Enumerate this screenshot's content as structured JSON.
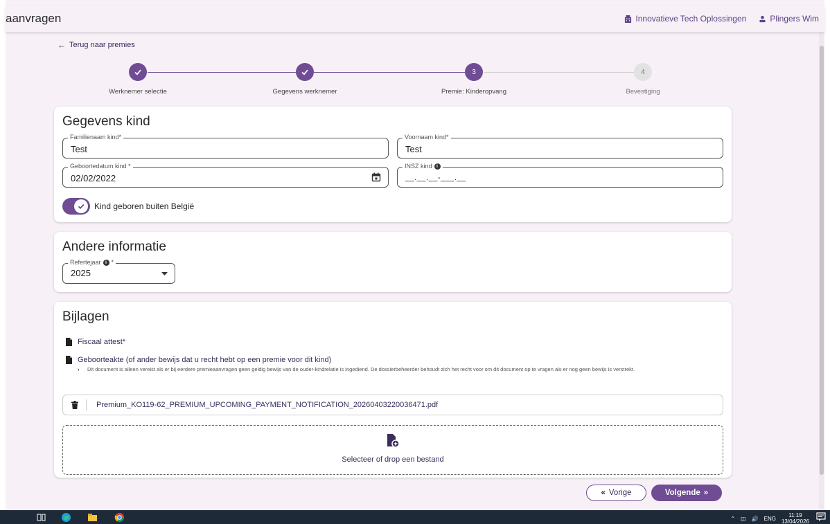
{
  "app": {
    "title": "aanvragen",
    "company": "Innovatieve Tech Oplossingen",
    "user": "Plingers Wim"
  },
  "back_link": "Terug naar premies",
  "stepper": [
    {
      "number": "1",
      "label": "Werknemer selectie",
      "state": "done"
    },
    {
      "number": "2",
      "label": "Gegevens werknemer",
      "state": "done"
    },
    {
      "number": "3",
      "label": "Premie: Kinderopvang",
      "state": "active"
    },
    {
      "number": "4",
      "label": "Bevestiging",
      "state": "pending"
    }
  ],
  "child": {
    "heading": "Gegevens kind",
    "lastname_label": "Familienaam kind*",
    "lastname_value": "Test",
    "firstname_label": "Voornaam kind*",
    "firstname_value": "Test",
    "birthdate_label": "Geboortedatum kind *",
    "birthdate_value": "02/02/2022",
    "insz_label": "INSZ kind",
    "insz_value": "__.__.__-___.__",
    "toggle_label": "Kind geboren buiten België",
    "toggle_on": true
  },
  "other": {
    "heading": "Andere informatie",
    "refyear_label": "Refertejaar",
    "refyear_required": "*",
    "refyear_value": "2025"
  },
  "attachments": {
    "heading": "Bijlagen",
    "doc1": "Fiscaal attest*",
    "doc2": "Geboorteakte (of ander bewijs dat u recht hebt op een premie voor dit kind)",
    "doc2_hint": "Dit document is alleen vereist als er bij eerdere premieaanvragen geen geldig bewijs van de ouder-kindrelatie is ingediend. De dossierbeheerder behoudt zich het recht voor om dit document op te vragen als er nog geen bewijs is verstrekt.",
    "file_name": "Premium_KO119-62_PREMIUM_UPCOMING_PAYMENT_NOTIFICATION_20260403220036471.pdf",
    "dropzone_text": "Selecteer of drop een bestand"
  },
  "nav": {
    "prev": "Vorige",
    "next": "Volgende"
  },
  "taskbar": {
    "lang": "ENG",
    "time": "11:19",
    "date": "13/04/2026"
  },
  "colors": {
    "accent": "#6f4c93",
    "background": "#f7f0f7",
    "taskbar": "#1e2a38"
  }
}
